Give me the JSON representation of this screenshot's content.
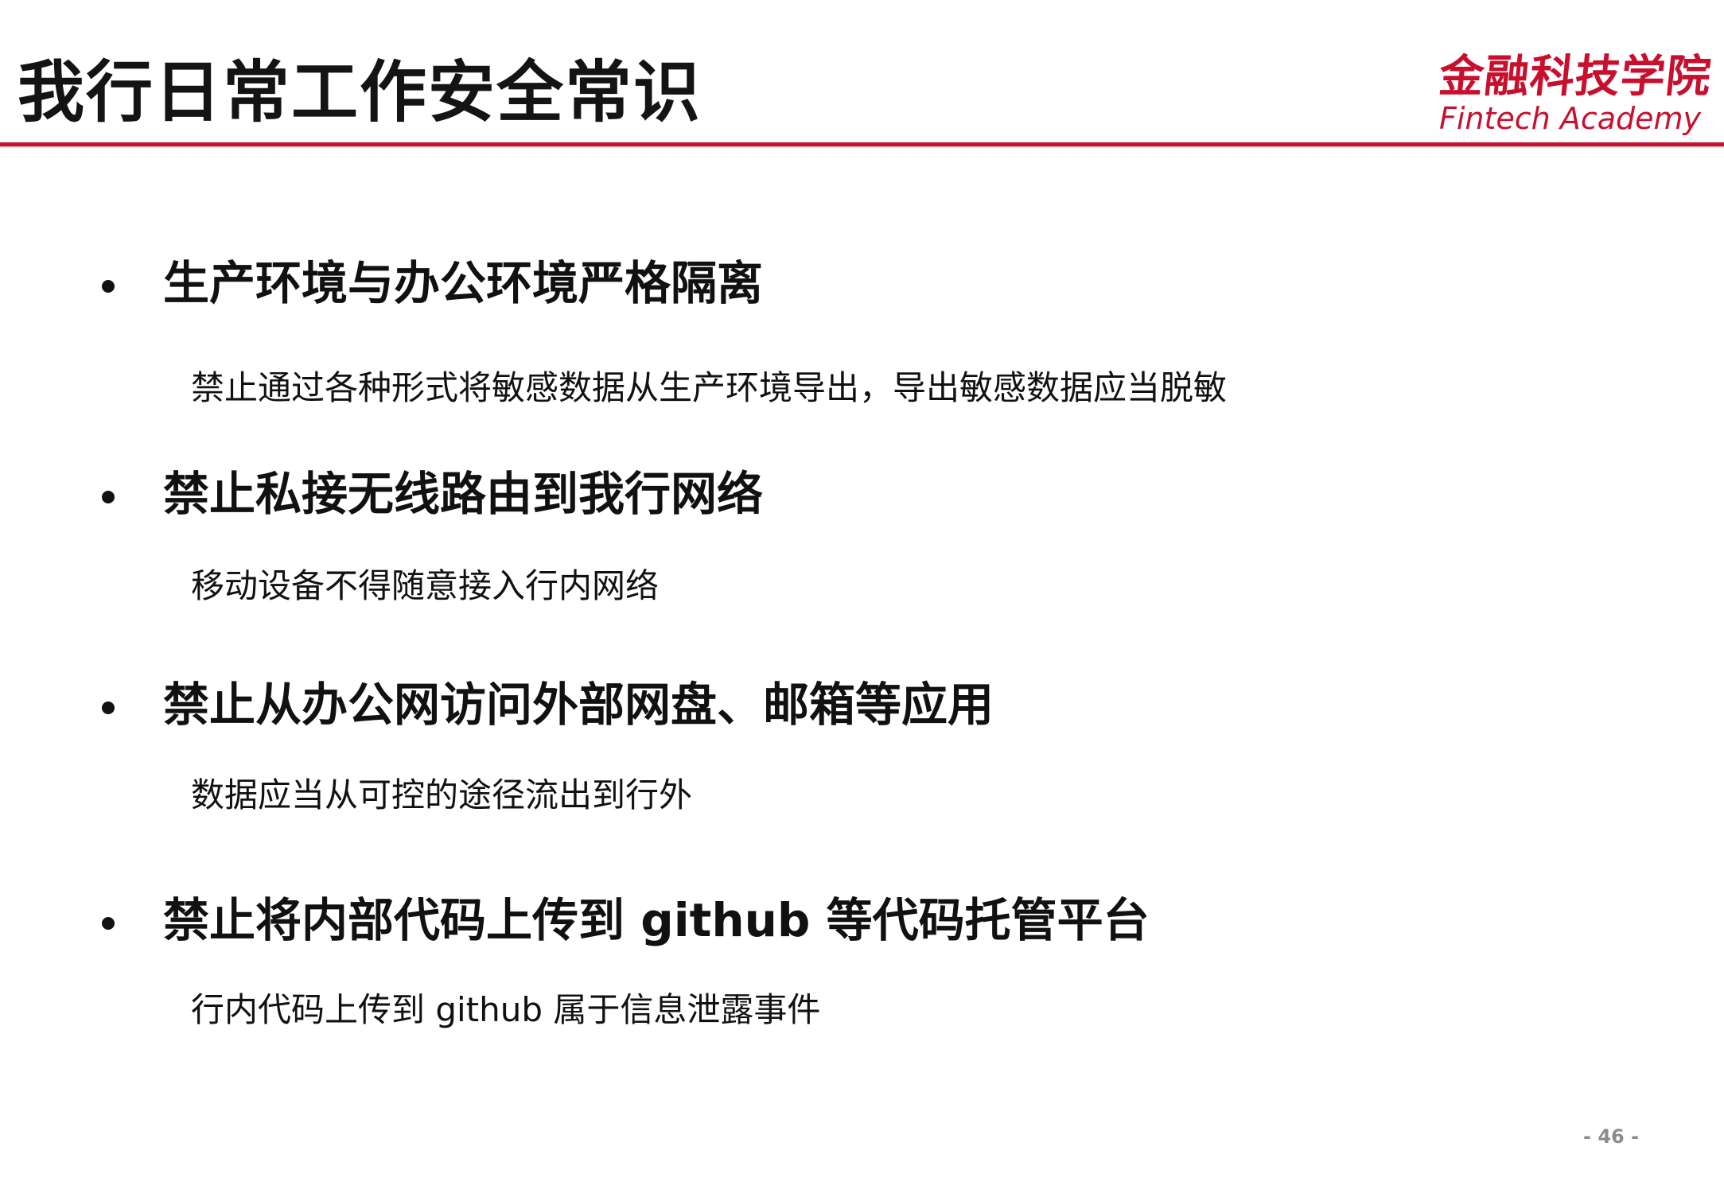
{
  "slide": {
    "title": "我行日常工作安全常识",
    "logo": {
      "cn": "金融科技学院",
      "en": "Fintech Academy"
    },
    "items": [
      {
        "heading": "生产环境与办公环境严格隔离",
        "detail": "禁止通过各种形式将敏感数据从生产环境导出，导出敏感数据应当脱敏"
      },
      {
        "heading": "禁止私接无线路由到我行网络",
        "detail": "移动设备不得随意接入行内网络"
      },
      {
        "heading": "禁止从办公网访问外部网盘、邮箱等应用",
        "detail": "数据应当从可控的途径流出到行外"
      },
      {
        "heading": "禁止将内部代码上传到 github 等代码托管平台",
        "detail": "行内代码上传到 github 属于信息泄露事件"
      }
    ],
    "page_number": "- 46 -"
  },
  "colors": {
    "accent": "#c8102e",
    "text": "#111111",
    "page_number": "#8c8c8c"
  }
}
